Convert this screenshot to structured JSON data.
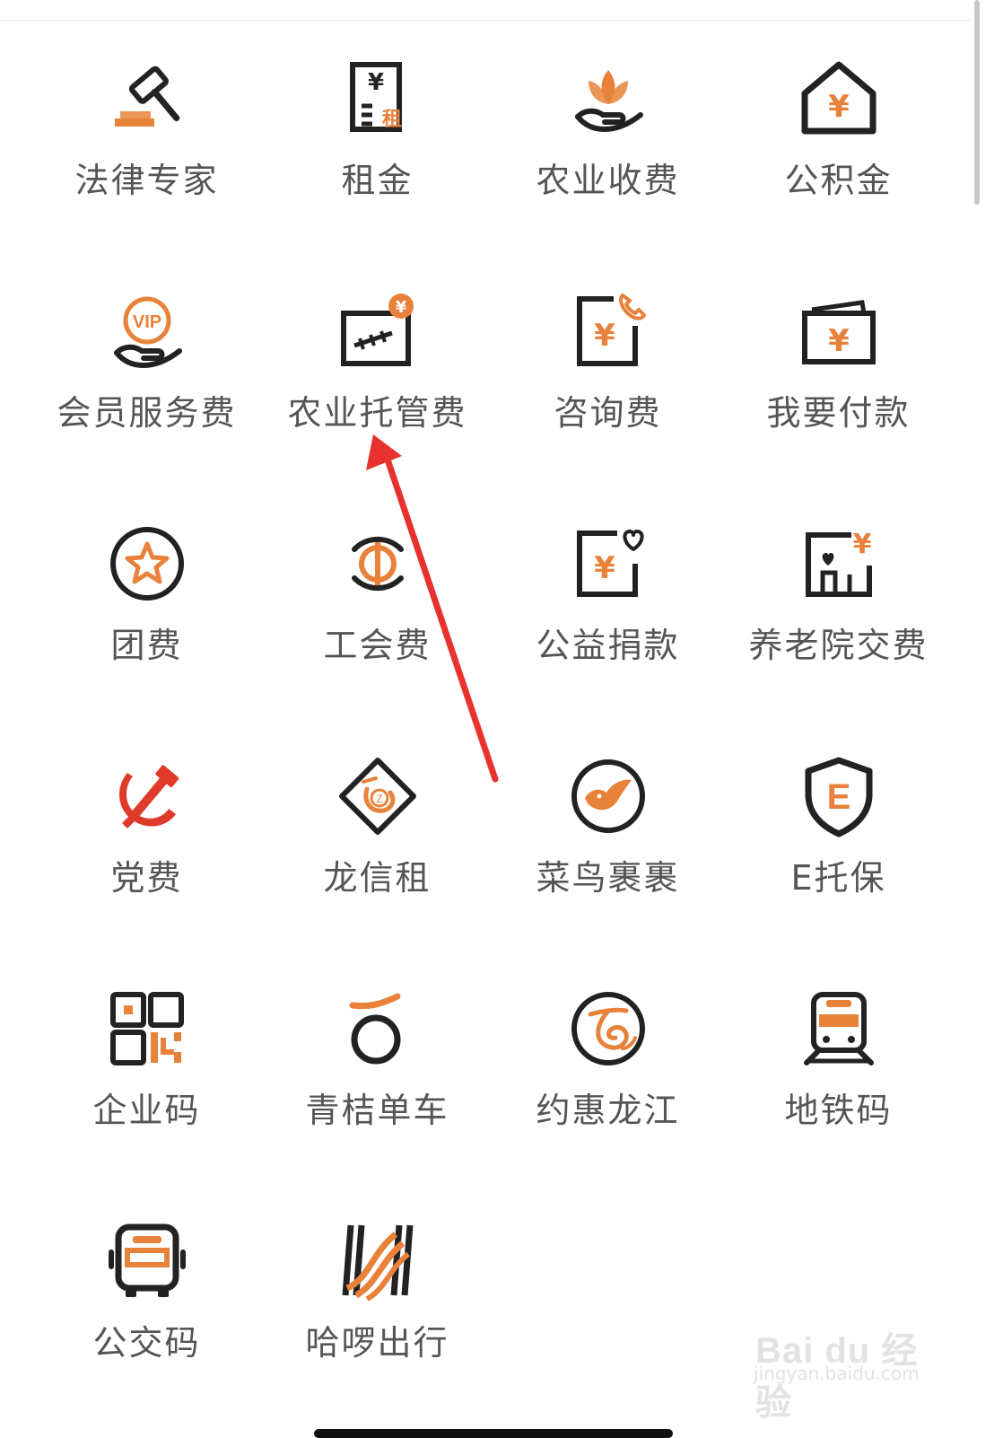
{
  "colors": {
    "accent": "#e8823a",
    "icon_stroke": "#222222",
    "label": "#555555",
    "annotation_arrow": "#e8322e",
    "party_red": "#e03a2a"
  },
  "grid": {
    "items": [
      {
        "label": "法律专家",
        "icon": "gavel-icon"
      },
      {
        "label": "租金",
        "icon": "rent-bill-icon"
      },
      {
        "label": "农业收费",
        "icon": "sprout-hand-icon"
      },
      {
        "label": "公积金",
        "icon": "house-yuan-icon"
      },
      {
        "label": "会员服务费",
        "icon": "vip-hand-icon"
      },
      {
        "label": "农业托管费",
        "icon": "field-coin-icon"
      },
      {
        "label": "咨询费",
        "icon": "phone-yuan-icon"
      },
      {
        "label": "我要付款",
        "icon": "wallet-yuan-icon"
      },
      {
        "label": "团费",
        "icon": "star-circle-icon"
      },
      {
        "label": "工会费",
        "icon": "union-emblem-icon"
      },
      {
        "label": "公益捐款",
        "icon": "heart-yuan-icon"
      },
      {
        "label": "养老院交费",
        "icon": "elder-home-icon"
      },
      {
        "label": "党费",
        "icon": "hammer-sickle-icon"
      },
      {
        "label": "龙信租",
        "icon": "diamond-logo-icon"
      },
      {
        "label": "菜鸟裹裹",
        "icon": "bird-circle-icon"
      },
      {
        "label": "E托保",
        "icon": "shield-e-icon"
      },
      {
        "label": "企业码",
        "icon": "qr-code-icon"
      },
      {
        "label": "青桔单车",
        "icon": "bike-logo-icon"
      },
      {
        "label": "约惠龙江",
        "icon": "swirl-circle-icon"
      },
      {
        "label": "地铁码",
        "icon": "metro-train-icon"
      },
      {
        "label": "公交码",
        "icon": "bus-icon"
      },
      {
        "label": "哈啰出行",
        "icon": "stripes-logo-icon"
      }
    ]
  },
  "watermark": {
    "brand": "Bai du 经验",
    "url": "jingyan.baidu.com"
  }
}
